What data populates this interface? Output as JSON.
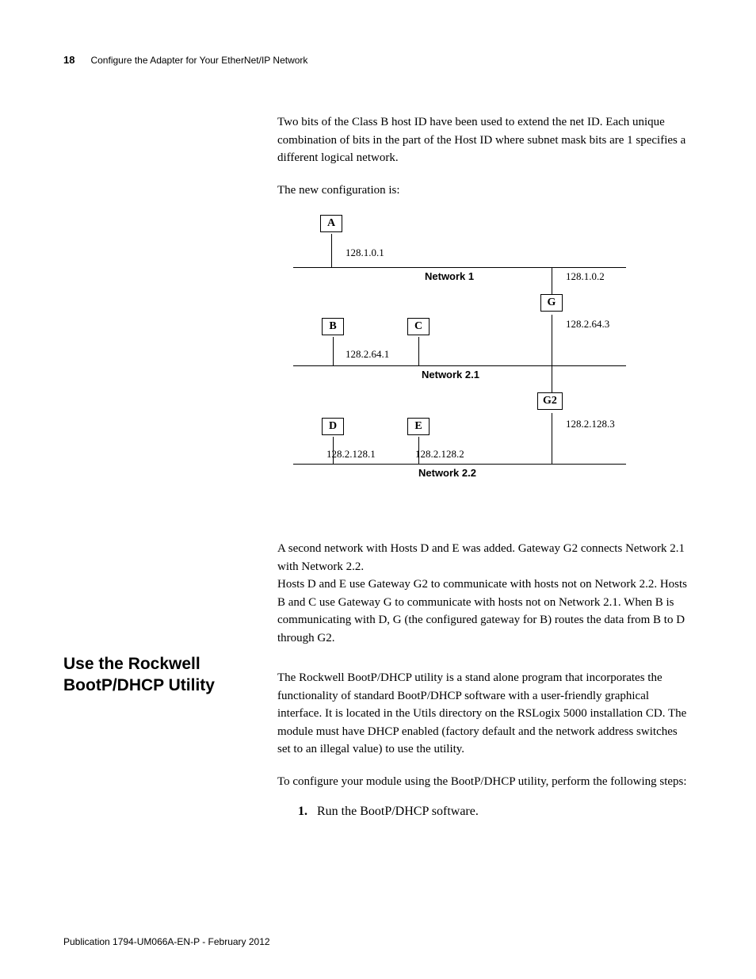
{
  "header": {
    "page_number": "18",
    "chapter_title": "Configure the Adapter for Your EtherNet/IP Network"
  },
  "paragraphs": {
    "p1": "Two bits of the Class B host ID have been used to extend the net ID. Each unique combination of bits in the part of the Host ID where subnet mask bits are 1 specifies a different logical network.",
    "p2": "The new configuration is:",
    "p3": "A second network with Hosts D and E was added. Gateway G2 connects Network 2.1 with Network 2.2.",
    "p4": "Hosts D and E use Gateway G2 to communicate with hosts not on Network 2.2. Hosts B and C use Gateway G to communicate with hosts not on Network 2.1. When B is communicating with D, G (the configured gateway for B) routes the data from B to D through G2.",
    "p5": "The Rockwell BootP/DHCP utility is a stand alone program that incorporates the functionality of standard BootP/DHCP software with a user-friendly graphical interface. It is located in the Utils directory on the RSLogix 5000 installation CD. The module must have DHCP enabled (factory default and the network address switches set to an illegal value) to use the utility.",
    "p6": "To configure your module using the BootP/DHCP utility, perform the following steps:"
  },
  "section_heading": "Use the Rockwell BootP/DHCP Utility",
  "steps": {
    "s1_num": "1.",
    "s1_text": "Run the BootP/DHCP software."
  },
  "diagram": {
    "nodes": {
      "A": "A",
      "B": "B",
      "C": "C",
      "D": "D",
      "E": "E",
      "G": "G",
      "G2": "G2"
    },
    "ips": {
      "a": "128.1.0.1",
      "g_top": "128.1.0.2",
      "g_bot": "128.2.64.3",
      "b": "128.2.64.1",
      "g2_bot": "128.2.128.3",
      "d": "128.2.128.1",
      "e": "128.2.128.2"
    },
    "networks": {
      "n1": "Network 1",
      "n21": "Network 2.1",
      "n22": "Network 2.2"
    }
  },
  "footer": "Publication 1794-UM066A-EN-P - February 2012"
}
